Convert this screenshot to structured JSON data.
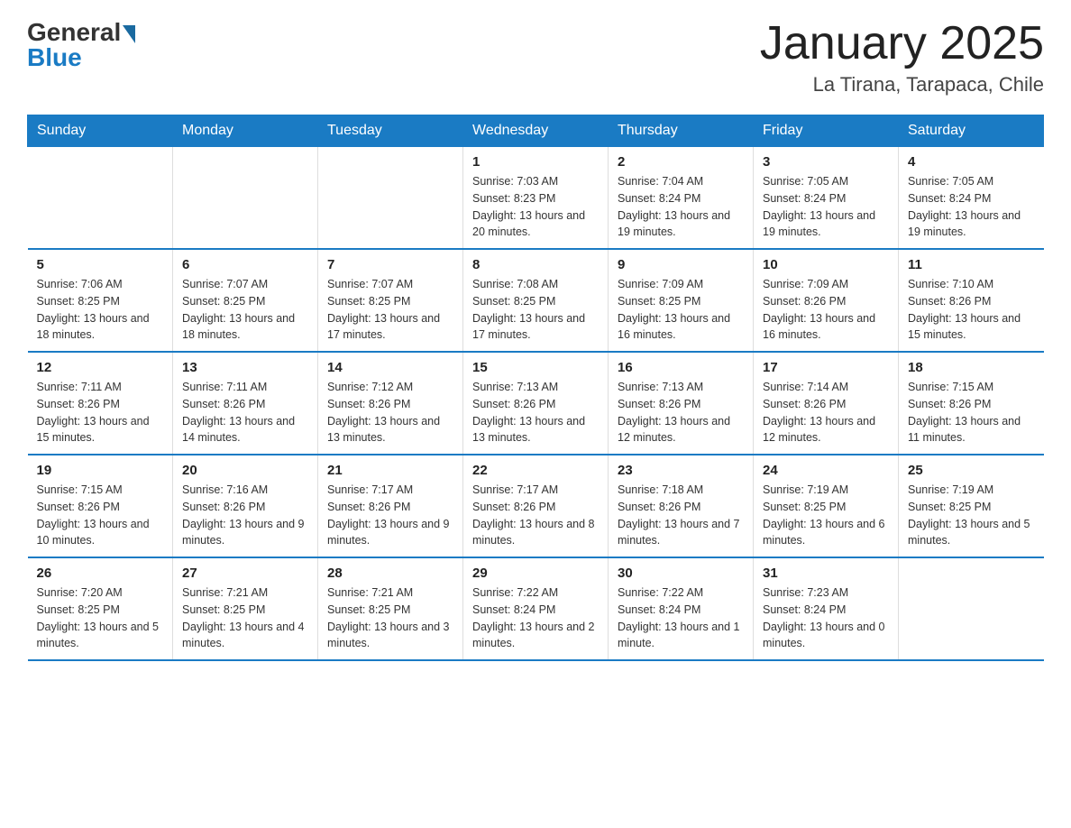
{
  "header": {
    "logo_general": "General",
    "logo_blue": "Blue",
    "month_title": "January 2025",
    "location": "La Tirana, Tarapaca, Chile"
  },
  "days_of_week": [
    "Sunday",
    "Monday",
    "Tuesday",
    "Wednesday",
    "Thursday",
    "Friday",
    "Saturday"
  ],
  "weeks": [
    [
      {
        "day": "",
        "info": ""
      },
      {
        "day": "",
        "info": ""
      },
      {
        "day": "",
        "info": ""
      },
      {
        "day": "1",
        "info": "Sunrise: 7:03 AM\nSunset: 8:23 PM\nDaylight: 13 hours and 20 minutes."
      },
      {
        "day": "2",
        "info": "Sunrise: 7:04 AM\nSunset: 8:24 PM\nDaylight: 13 hours and 19 minutes."
      },
      {
        "day": "3",
        "info": "Sunrise: 7:05 AM\nSunset: 8:24 PM\nDaylight: 13 hours and 19 minutes."
      },
      {
        "day": "4",
        "info": "Sunrise: 7:05 AM\nSunset: 8:24 PM\nDaylight: 13 hours and 19 minutes."
      }
    ],
    [
      {
        "day": "5",
        "info": "Sunrise: 7:06 AM\nSunset: 8:25 PM\nDaylight: 13 hours and 18 minutes."
      },
      {
        "day": "6",
        "info": "Sunrise: 7:07 AM\nSunset: 8:25 PM\nDaylight: 13 hours and 18 minutes."
      },
      {
        "day": "7",
        "info": "Sunrise: 7:07 AM\nSunset: 8:25 PM\nDaylight: 13 hours and 17 minutes."
      },
      {
        "day": "8",
        "info": "Sunrise: 7:08 AM\nSunset: 8:25 PM\nDaylight: 13 hours and 17 minutes."
      },
      {
        "day": "9",
        "info": "Sunrise: 7:09 AM\nSunset: 8:25 PM\nDaylight: 13 hours and 16 minutes."
      },
      {
        "day": "10",
        "info": "Sunrise: 7:09 AM\nSunset: 8:26 PM\nDaylight: 13 hours and 16 minutes."
      },
      {
        "day": "11",
        "info": "Sunrise: 7:10 AM\nSunset: 8:26 PM\nDaylight: 13 hours and 15 minutes."
      }
    ],
    [
      {
        "day": "12",
        "info": "Sunrise: 7:11 AM\nSunset: 8:26 PM\nDaylight: 13 hours and 15 minutes."
      },
      {
        "day": "13",
        "info": "Sunrise: 7:11 AM\nSunset: 8:26 PM\nDaylight: 13 hours and 14 minutes."
      },
      {
        "day": "14",
        "info": "Sunrise: 7:12 AM\nSunset: 8:26 PM\nDaylight: 13 hours and 13 minutes."
      },
      {
        "day": "15",
        "info": "Sunrise: 7:13 AM\nSunset: 8:26 PM\nDaylight: 13 hours and 13 minutes."
      },
      {
        "day": "16",
        "info": "Sunrise: 7:13 AM\nSunset: 8:26 PM\nDaylight: 13 hours and 12 minutes."
      },
      {
        "day": "17",
        "info": "Sunrise: 7:14 AM\nSunset: 8:26 PM\nDaylight: 13 hours and 12 minutes."
      },
      {
        "day": "18",
        "info": "Sunrise: 7:15 AM\nSunset: 8:26 PM\nDaylight: 13 hours and 11 minutes."
      }
    ],
    [
      {
        "day": "19",
        "info": "Sunrise: 7:15 AM\nSunset: 8:26 PM\nDaylight: 13 hours and 10 minutes."
      },
      {
        "day": "20",
        "info": "Sunrise: 7:16 AM\nSunset: 8:26 PM\nDaylight: 13 hours and 9 minutes."
      },
      {
        "day": "21",
        "info": "Sunrise: 7:17 AM\nSunset: 8:26 PM\nDaylight: 13 hours and 9 minutes."
      },
      {
        "day": "22",
        "info": "Sunrise: 7:17 AM\nSunset: 8:26 PM\nDaylight: 13 hours and 8 minutes."
      },
      {
        "day": "23",
        "info": "Sunrise: 7:18 AM\nSunset: 8:26 PM\nDaylight: 13 hours and 7 minutes."
      },
      {
        "day": "24",
        "info": "Sunrise: 7:19 AM\nSunset: 8:25 PM\nDaylight: 13 hours and 6 minutes."
      },
      {
        "day": "25",
        "info": "Sunrise: 7:19 AM\nSunset: 8:25 PM\nDaylight: 13 hours and 5 minutes."
      }
    ],
    [
      {
        "day": "26",
        "info": "Sunrise: 7:20 AM\nSunset: 8:25 PM\nDaylight: 13 hours and 5 minutes."
      },
      {
        "day": "27",
        "info": "Sunrise: 7:21 AM\nSunset: 8:25 PM\nDaylight: 13 hours and 4 minutes."
      },
      {
        "day": "28",
        "info": "Sunrise: 7:21 AM\nSunset: 8:25 PM\nDaylight: 13 hours and 3 minutes."
      },
      {
        "day": "29",
        "info": "Sunrise: 7:22 AM\nSunset: 8:24 PM\nDaylight: 13 hours and 2 minutes."
      },
      {
        "day": "30",
        "info": "Sunrise: 7:22 AM\nSunset: 8:24 PM\nDaylight: 13 hours and 1 minute."
      },
      {
        "day": "31",
        "info": "Sunrise: 7:23 AM\nSunset: 8:24 PM\nDaylight: 13 hours and 0 minutes."
      },
      {
        "day": "",
        "info": ""
      }
    ]
  ]
}
